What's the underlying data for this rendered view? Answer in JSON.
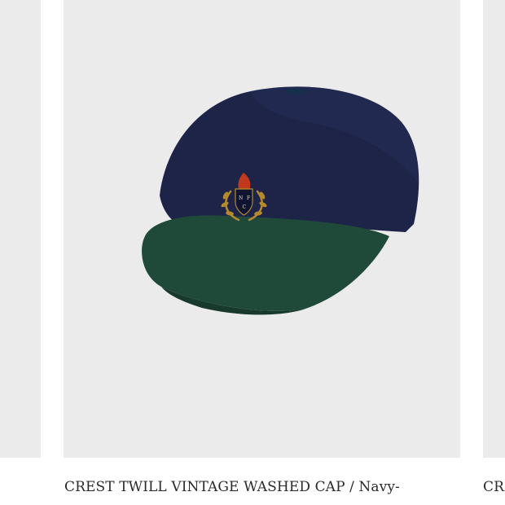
{
  "product_grid": {
    "items": [
      {
        "title": ""
      },
      {
        "title": "CREST TWILL VINTAGE WASHED CAP / Navy-",
        "image_icon": "baseball-cap-icon",
        "crest_letters": [
          "N",
          "F",
          "C"
        ]
      },
      {
        "title": "CREST TWILL VINTAGE WASHED CAP / Navy-"
      }
    ]
  },
  "colors": {
    "image_background": "#ebebeb",
    "cap_crown": "#1d2448",
    "cap_brim": "#1f4a3a",
    "crest_gold": "#b48a2c",
    "crest_red": "#c0391d"
  }
}
